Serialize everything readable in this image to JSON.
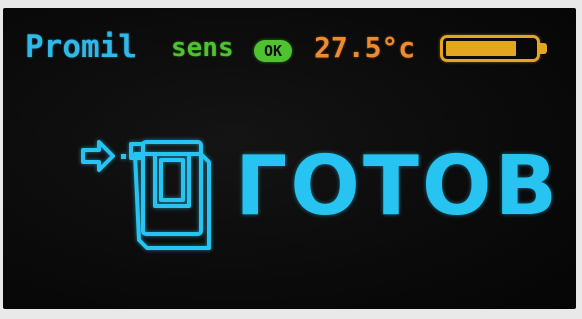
{
  "status_bar": {
    "device_name": "Promil",
    "sensor_label": "sens",
    "sensor_status": "OK",
    "temperature": "27.5°c",
    "battery_level": 0.8
  },
  "main": {
    "status": "ГОТОВ",
    "icon": "breathalyzer-arrow-icon"
  },
  "colors": {
    "device_name": "#2fb8e8",
    "sensor": "#4ec22f",
    "temperature": "#f08a2c",
    "battery": "#e3a71f",
    "status": "#27c4f2",
    "background": "#0b0b0b"
  }
}
